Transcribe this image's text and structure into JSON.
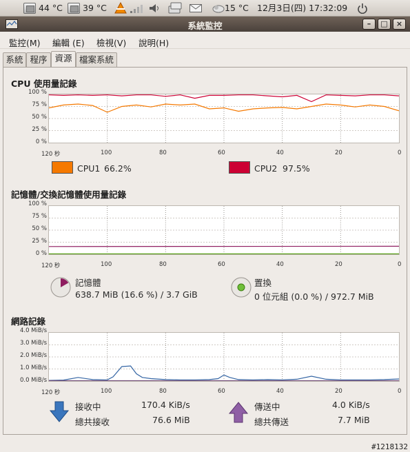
{
  "top_panel": {
    "temp1": "44 °C",
    "temp2": "39 °C",
    "weather": "15 °C",
    "datetime": "12月3日(四) 17:32:09",
    "icons": [
      "cpu-temp-icon",
      "cpu-temp-icon",
      "vlc-icon",
      "network-icon",
      "volume-icon",
      "network-manager-icon",
      "mail-icon",
      "weather-icon",
      "power-icon"
    ]
  },
  "window": {
    "title": "系統監控"
  },
  "menubar": {
    "monitor": "監控(M)",
    "edit": "編輯 (E)",
    "view": "檢視(V)",
    "help": "說明(H)"
  },
  "tabs": [
    "系統",
    "程序",
    "資源",
    "檔案系統"
  ],
  "active_tab": "資源",
  "cpu": {
    "title": "CPU 使用量記錄",
    "y_ticks": [
      "100 %",
      "75 %",
      "50 %",
      "25 %",
      "0 %"
    ],
    "x_ticks": [
      "120 秒",
      "100",
      "80",
      "60",
      "40",
      "20",
      "0"
    ],
    "cpu1_label": "CPU1",
    "cpu1_value": "66.2%",
    "cpu1_color": "#f57900",
    "cpu2_label": "CPU2",
    "cpu2_value": "97.5%",
    "cpu2_color": "#cc0033"
  },
  "memory": {
    "title": "記憶體/交換記憶體使用量記錄",
    "y_ticks": [
      "100 %",
      "75 %",
      "50 %",
      "25 %",
      "0 %"
    ],
    "x_ticks": [
      "120 秒",
      "100",
      "80",
      "60",
      "40",
      "20",
      "0"
    ],
    "mem_label": "記憶體",
    "mem_value": "638.7 MiB (16.6 %) / 3.7 GiB",
    "mem_color": "#8f1d60",
    "swap_label": "置換",
    "swap_value": "0 位元組 (0.0 %) / 972.7 MiB",
    "swap_color": "#4e9a06"
  },
  "network": {
    "title": "網路記錄",
    "y_ticks": [
      "4.0 MiB/s",
      "3.0 MiB/s",
      "2.0 MiB/s",
      "1.0 MiB/s",
      "0.0 MiB/s"
    ],
    "x_ticks": [
      "120 秒",
      "100",
      "80",
      "60",
      "40",
      "20",
      "0"
    ],
    "recv_label": "接收中",
    "recv_value": "170.4 KiB/s",
    "recv_total_label": "總共接收",
    "recv_total_value": "76.6 MiB",
    "recv_color": "#3465a4",
    "send_label": "傳送中",
    "send_value": "4.0 KiB/s",
    "send_total_label": "總共傳送",
    "send_total_value": "7.7 MiB",
    "send_color": "#75507b"
  },
  "watermark": "#1218132",
  "chart_data": [
    {
      "type": "line",
      "title": "CPU 使用量記錄",
      "x_unit": "秒",
      "x": [
        120,
        115,
        110,
        105,
        100,
        95,
        90,
        85,
        80,
        75,
        70,
        65,
        60,
        55,
        50,
        45,
        40,
        35,
        30,
        25,
        20,
        15,
        10,
        5,
        0
      ],
      "xlim": [
        120,
        0
      ],
      "ylim": [
        0,
        100
      ],
      "series": [
        {
          "name": "CPU1",
          "values": [
            72,
            78,
            80,
            77,
            63,
            75,
            78,
            74,
            80,
            78,
            80,
            70,
            72,
            65,
            70,
            72,
            73,
            70,
            75,
            80,
            78,
            74,
            78,
            75,
            66
          ]
        },
        {
          "name": "CPU2",
          "values": [
            99,
            98,
            99,
            98,
            99,
            97,
            99,
            99,
            96,
            99,
            92,
            98,
            98,
            99,
            99,
            97,
            95,
            98,
            85,
            99,
            98,
            97,
            99,
            99,
            97
          ]
        }
      ]
    },
    {
      "type": "line",
      "title": "記憶體/交換記憶體使用量記錄",
      "x_unit": "秒",
      "x": [
        120,
        0
      ],
      "xlim": [
        120,
        0
      ],
      "ylim": [
        0,
        100
      ],
      "series": [
        {
          "name": "記憶體",
          "values": [
            16.0,
            16.6
          ]
        },
        {
          "name": "置換",
          "values": [
            0.0,
            0.0
          ]
        }
      ]
    },
    {
      "type": "line",
      "title": "網路記錄",
      "x_unit": "秒",
      "x": [
        120,
        115,
        110,
        105,
        100,
        98,
        95,
        92,
        90,
        88,
        85,
        80,
        75,
        70,
        65,
        62,
        60,
        58,
        55,
        50,
        45,
        40,
        35,
        30,
        25,
        20,
        15,
        10,
        5,
        0
      ],
      "xlim": [
        120,
        0
      ],
      "ylim": [
        0,
        4.0
      ],
      "series": [
        {
          "name": "接收中",
          "values": [
            0.05,
            0.08,
            0.3,
            0.12,
            0.1,
            0.35,
            1.2,
            1.25,
            0.6,
            0.3,
            0.2,
            0.12,
            0.1,
            0.1,
            0.12,
            0.2,
            0.5,
            0.3,
            0.12,
            0.1,
            0.12,
            0.1,
            0.15,
            0.4,
            0.15,
            0.1,
            0.1,
            0.1,
            0.12,
            0.17
          ]
        },
        {
          "name": "傳送中",
          "values": [
            0.01,
            0.01,
            0.01,
            0.01,
            0.01,
            0.01,
            0.02,
            0.02,
            0.01,
            0.01,
            0.01,
            0.01,
            0.01,
            0.01,
            0.01,
            0.01,
            0.01,
            0.01,
            0.01,
            0.01,
            0.01,
            0.01,
            0.01,
            0.01,
            0.01,
            0.01,
            0.01,
            0.01,
            0.01,
            0.004
          ]
        }
      ]
    }
  ]
}
